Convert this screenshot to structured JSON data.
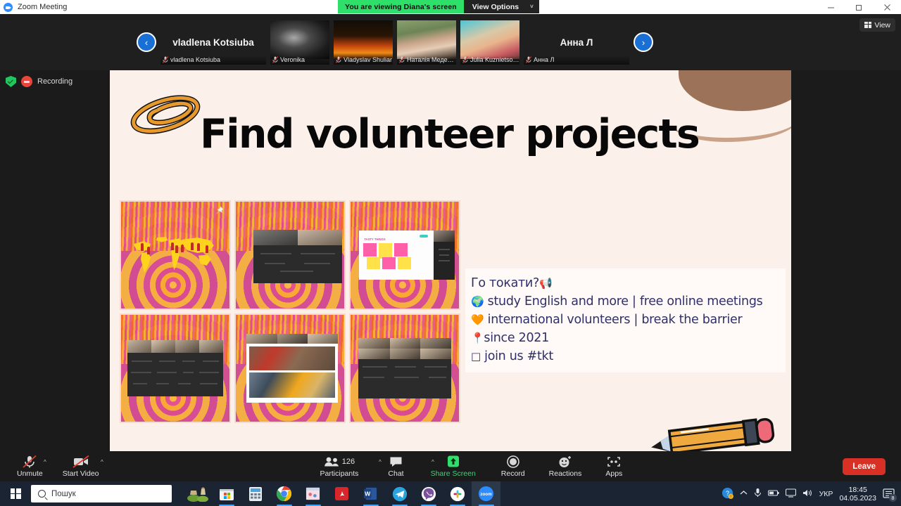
{
  "window": {
    "title": "Zoom Meeting",
    "app_icon": "zoom-icon",
    "minimize": "minimize-icon",
    "maximize": "maximize-icon",
    "close": "close-icon"
  },
  "share_banner": {
    "status_text": "You are viewing Diana's screen",
    "view_options_label": "View Options",
    "chevron": "˅"
  },
  "view_button": {
    "label": "View",
    "icon": "grid-icon"
  },
  "recording": {
    "label": "Recording",
    "shield_icon": "encryption-shield-icon",
    "dot_icon": "record-dot-icon"
  },
  "filmstrip": {
    "prev_arrow": "‹",
    "next_arrow": "›",
    "left_speaker": "vladlena Kotsiuba",
    "right_speaker": "Анна Л",
    "participants": [
      {
        "name": "vladlena Kotsiuba",
        "muted": true
      },
      {
        "name": "Veronika",
        "muted": true
      },
      {
        "name": "Vladyslav Shuliar",
        "muted": true
      },
      {
        "name": "Наталія Медецька",
        "muted": true
      },
      {
        "name": "Julia Kuznietsova",
        "muted": true
      },
      {
        "name": "Анна Л",
        "muted": true
      }
    ]
  },
  "slide": {
    "title": "Find volunteer projects",
    "clip_icon": "paperclip-icon",
    "pencil_icon": "pencil-icon",
    "pushpin_icon": "pushpin-icon",
    "text_lines": [
      {
        "emoji": "📢",
        "emoji_position": "after",
        "text": "Го токати?"
      },
      {
        "emoji": "🌍",
        "emoji_position": "before",
        "text": "study English and more | free online meetings"
      },
      {
        "emoji": "🧡",
        "emoji_position": "before",
        "text": "international volunteers | break the barrier"
      },
      {
        "emoji": "📍",
        "emoji_position": "before",
        "text": "since 2021"
      },
      {
        "emoji": "□",
        "emoji_position": "before",
        "text": "join us #tkt"
      }
    ],
    "gallery": [
      {
        "caption": "world-map-with-pins"
      },
      {
        "caption": "zoom-meeting-screenshot-2-people"
      },
      {
        "caption": "miro-board-tasty-things"
      },
      {
        "caption": "zoom-meeting-screenshot-gallery"
      },
      {
        "caption": "zoom-meeting-screenshot-photo-collage"
      },
      {
        "caption": "zoom-meeting-screenshot-many-people"
      }
    ],
    "miro_board_title": "TASTY THINGS"
  },
  "toolbar": {
    "mute": {
      "label": "Unmute",
      "icon": "microphone-muted-icon",
      "has_caret": true
    },
    "video": {
      "label": "Start Video",
      "icon": "video-off-icon",
      "has_caret": true
    },
    "participants": {
      "label": "Participants",
      "count": "126",
      "icon": "people-icon",
      "has_caret": true
    },
    "chat": {
      "label": "Chat",
      "icon": "chat-bubble-icon",
      "has_caret": true
    },
    "share": {
      "label": "Share Screen",
      "icon": "share-screen-icon",
      "active": true
    },
    "record": {
      "label": "Record",
      "icon": "record-circle-icon"
    },
    "reactions": {
      "label": "Reactions",
      "icon": "smiley-reaction-icon"
    },
    "apps": {
      "label": "Apps",
      "icon": "apps-icon"
    },
    "leave": {
      "label": "Leave"
    }
  },
  "taskbar": {
    "start_label": "start-button",
    "search_placeholder": "Пошук",
    "apps": [
      {
        "name": "windows-widget-icon"
      },
      {
        "name": "microsoft-store-icon"
      },
      {
        "name": "calculator-icon"
      },
      {
        "name": "google-chrome-icon"
      },
      {
        "name": "paint-icon"
      },
      {
        "name": "adobe-reader-icon"
      },
      {
        "name": "microsoft-word-icon"
      },
      {
        "name": "telegram-icon"
      },
      {
        "name": "viber-icon"
      },
      {
        "name": "slack-icon"
      },
      {
        "name": "zoom-icon"
      }
    ],
    "tray": {
      "language": "УКР",
      "time": "18:45",
      "date": "04.05.2023",
      "notification_count": "8"
    }
  },
  "colors": {
    "zoom_dark": "#1b1b1b",
    "share_green": "#2ee06a",
    "leave_red": "#d93025",
    "slide_bg": "#fcf1ea",
    "slide_text": "#2f2f6b",
    "taskbar": "#1b2433"
  }
}
